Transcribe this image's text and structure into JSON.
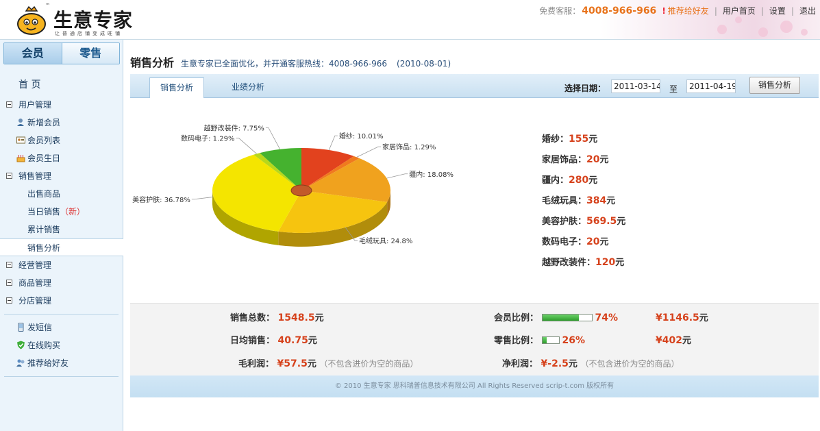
{
  "header": {
    "logo_name": "生意专家",
    "logo_tm": "™",
    "logo_slogan": "让普通店铺变成旺铺",
    "service_label": "免费客服：",
    "service_phone": "4008-966-966",
    "recommend_bang": "!",
    "recommend_label": "推荐给好友",
    "links": [
      "用户首页",
      "设置",
      "退出"
    ],
    "separator": "|",
    "colors": {
      "accent_orange": "#e8731b",
      "brand_blue": "#1d5a8e"
    }
  },
  "sidebar": {
    "tabs": [
      "会员",
      "零售"
    ],
    "home": "首 页",
    "groups": [
      {
        "label": "用户管理",
        "items": [
          {
            "label": "新增会员",
            "icon": "user-add-icon"
          },
          {
            "label": "会员列表",
            "icon": "member-card-icon"
          },
          {
            "label": "会员生日",
            "icon": "birthday-cake-icon"
          }
        ]
      },
      {
        "label": "销售管理",
        "items": [
          {
            "label": "出售商品"
          },
          {
            "label": "当日销售",
            "badge": "（新）"
          },
          {
            "label": "累计销售"
          },
          {
            "label": "销售分析",
            "active": true
          }
        ]
      },
      {
        "label": "经营管理"
      },
      {
        "label": "商品管理"
      },
      {
        "label": "分店管理"
      }
    ],
    "extras": [
      {
        "label": "发短信",
        "icon": "mobile-phone-icon"
      },
      {
        "label": "在线购买",
        "icon": "shield-check-icon"
      },
      {
        "label": "推荐给好友",
        "icon": "share-users-icon"
      }
    ]
  },
  "main": {
    "title": "销售分析",
    "notice": "生意专家已全面优化，并开通客服热线：4008-966-966",
    "notice_date": "(2010-08-01)",
    "tabs": [
      "销售分析",
      "业绩分析"
    ],
    "date_label": "选择日期：",
    "date_from": "2011-03-14",
    "date_to": "2011-04-19",
    "date_to_label": "至",
    "analyze_button": "销售分析"
  },
  "chart_data": {
    "type": "pie",
    "categories": [
      "婚纱",
      "家居饰品",
      "疆内",
      "毛绒玩具",
      "美容护肤",
      "数码电子",
      "越野改装件"
    ],
    "values": [
      155,
      20,
      280,
      384,
      569.5,
      20,
      120
    ],
    "percent_labels": [
      "10.01%",
      "1.29%",
      "18.08%",
      "24.8%",
      "36.78%",
      "1.29%",
      "7.75%"
    ],
    "colors": [
      "#e2421e",
      "#f07a1e",
      "#f0a21e",
      "#f6c40f",
      "#f4e500",
      "#b8d81a",
      "#45b22f"
    ],
    "unit": "元"
  },
  "legend": {
    "unit": "元",
    "rows": [
      {
        "label": "婚纱：",
        "value": "155"
      },
      {
        "label": "家居饰品：",
        "value": "20"
      },
      {
        "label": "疆内：",
        "value": "280"
      },
      {
        "label": "毛绒玩具：",
        "value": "384"
      },
      {
        "label": "美容护肤：",
        "value": "569.5"
      },
      {
        "label": "数码电子：",
        "value": "20"
      },
      {
        "label": "越野改装件：",
        "value": "120"
      }
    ]
  },
  "summary": {
    "total_label": "销售总数：",
    "total_value": "1548.5",
    "avg_label": "日均销售：",
    "avg_value": "40.75",
    "gross_label": "毛利润：",
    "gross_value": "¥57.5",
    "gross_note": "（不包含进价为空的商品）",
    "member_label": "会员比例：",
    "member_ratio": 0.74,
    "member_pct": "74%",
    "member_amount": "¥1146.5",
    "retail_label": "零售比例：",
    "retail_ratio": 0.26,
    "retail_pct": "26%",
    "retail_amount": "¥402",
    "net_label": "净利润：",
    "net_value": "¥-2.5",
    "net_note": "（不包含进价为空的商品）",
    "unit": "元"
  },
  "footer": {
    "text": "© 2010 生意专家  思科瑞普信息技术有限公司  All Rights Reserved scrip-t.com 版权所有"
  }
}
